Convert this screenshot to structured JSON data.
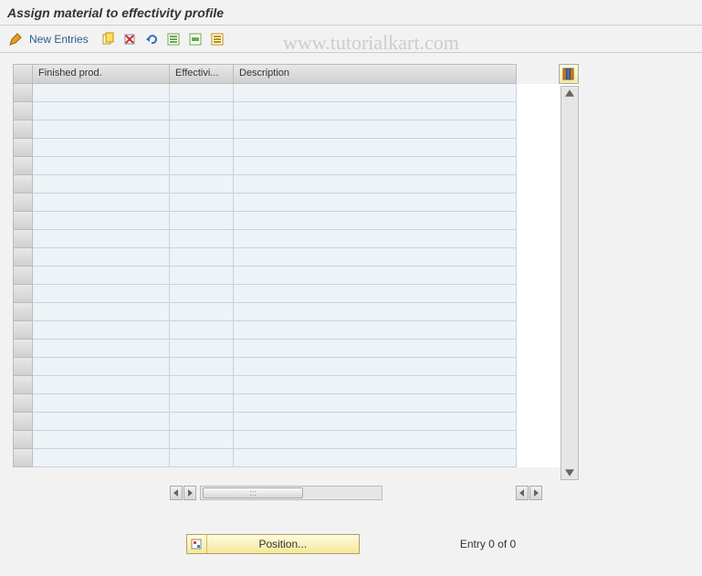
{
  "title": "Assign material to effectivity profile",
  "toolbar": {
    "new_entries_label": "New Entries"
  },
  "watermark": "www.tutorialkart.com",
  "table": {
    "columns": {
      "finished_prod": "Finished prod.",
      "effectivity": "Effectivi...",
      "description": "Description"
    },
    "row_count": 21
  },
  "footer": {
    "position_label": "Position...",
    "entry_text": "Entry 0 of 0"
  },
  "icons": {
    "pencil": "pencil-icon",
    "copy": "copy-icon",
    "delete": "delete-icon",
    "undo": "undo-icon",
    "select_all": "select-all-icon",
    "select_block": "select-block-icon",
    "deselect": "deselect-icon",
    "config": "configure-columns-icon"
  }
}
